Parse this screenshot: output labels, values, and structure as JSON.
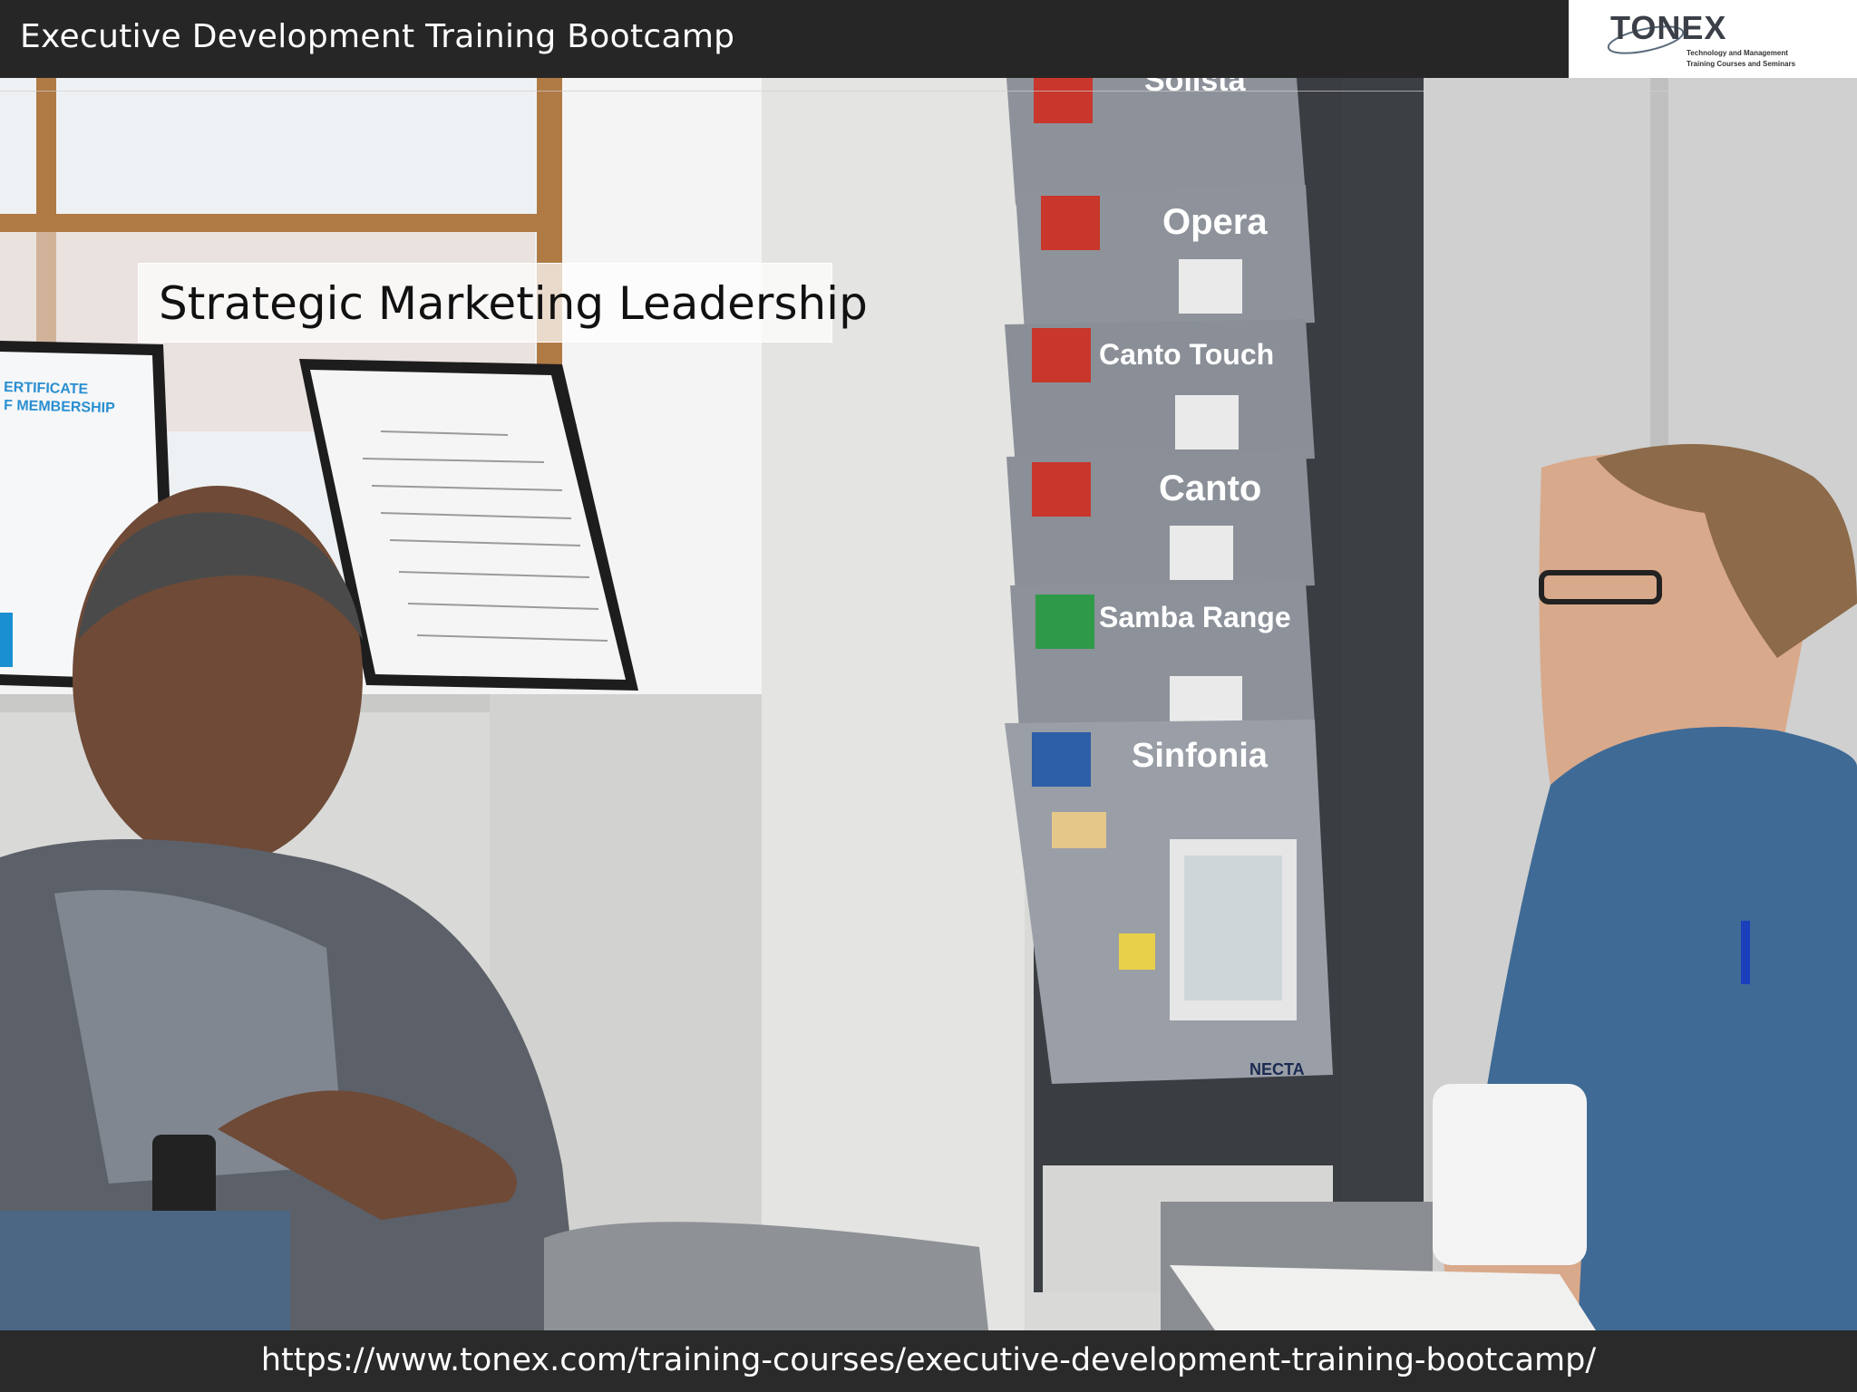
{
  "header": {
    "title": "Executive Development Training Bootcamp"
  },
  "logo": {
    "word": "TONEX",
    "tagline_line1": "Technology and Management",
    "tagline_line2": "Training Courses and Seminars"
  },
  "slide": {
    "title": "Strategic Marketing Leadership"
  },
  "photo": {
    "certificate_text_line1": "ERTIFICATE",
    "certificate_text_line2": "F MEMBERSHIP",
    "brochures": [
      "Solista",
      "Opera",
      "Canto Touch",
      "Canto",
      "Samba Range",
      "Sinfonia"
    ],
    "brochure_footer": "NECTA"
  },
  "footer": {
    "url": "https://www.tonex.com/training-courses/executive-development-training-bootcamp/"
  },
  "colors": {
    "header_bg": "#262626",
    "footer_bg": "#2a2a2a",
    "logo_bg": "#ffffff"
  }
}
